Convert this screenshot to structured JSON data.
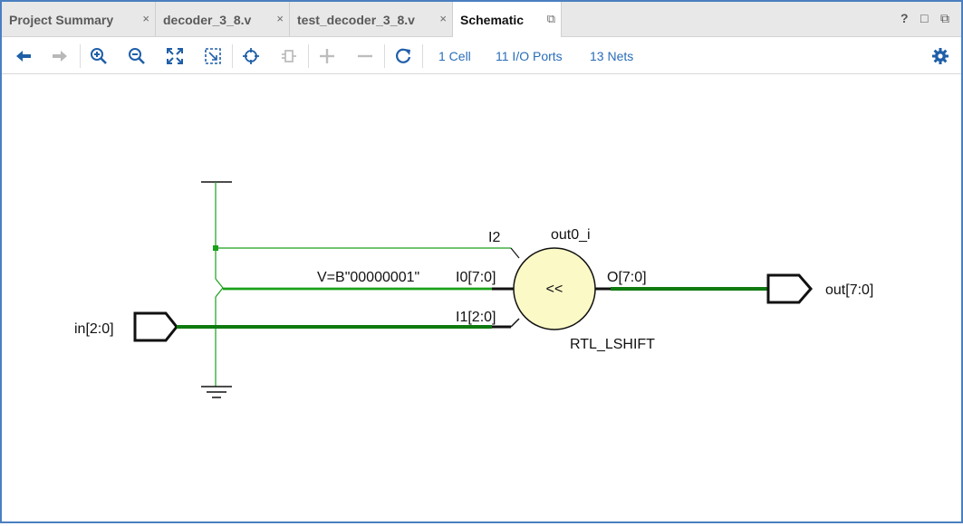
{
  "tabs": [
    {
      "label": "Project Summary",
      "close": "×"
    },
    {
      "label": "decoder_3_8.v",
      "close": "×"
    },
    {
      "label": "test_decoder_3_8.v",
      "close": "×"
    },
    {
      "label": "Schematic",
      "close": "⧉"
    }
  ],
  "window_controls": {
    "help": "?",
    "restore": "□",
    "float": "⧉"
  },
  "toolbar": {
    "stats": {
      "cells": "1 Cell",
      "ports": "11 I/O Ports",
      "nets": "13 Nets"
    }
  },
  "schematic": {
    "input_port": "in[2:0]",
    "output_port": "out[7:0]",
    "cell_instance": "out0_i",
    "cell_type": "RTL_LSHIFT",
    "cell_symbol": "<<",
    "pins": {
      "i2": "I2",
      "i0": "I0[7:0]",
      "i1": "I1[2:0]",
      "o": "O[7:0]"
    },
    "constant": "V=B\"00000001\""
  },
  "colors": {
    "net_green": "#1aa01a",
    "bus_green": "#0f7a0f",
    "cell_fill": "#fbf9c6",
    "accent_blue": "#2a6db8",
    "frame_blue": "#4a7fc1"
  }
}
